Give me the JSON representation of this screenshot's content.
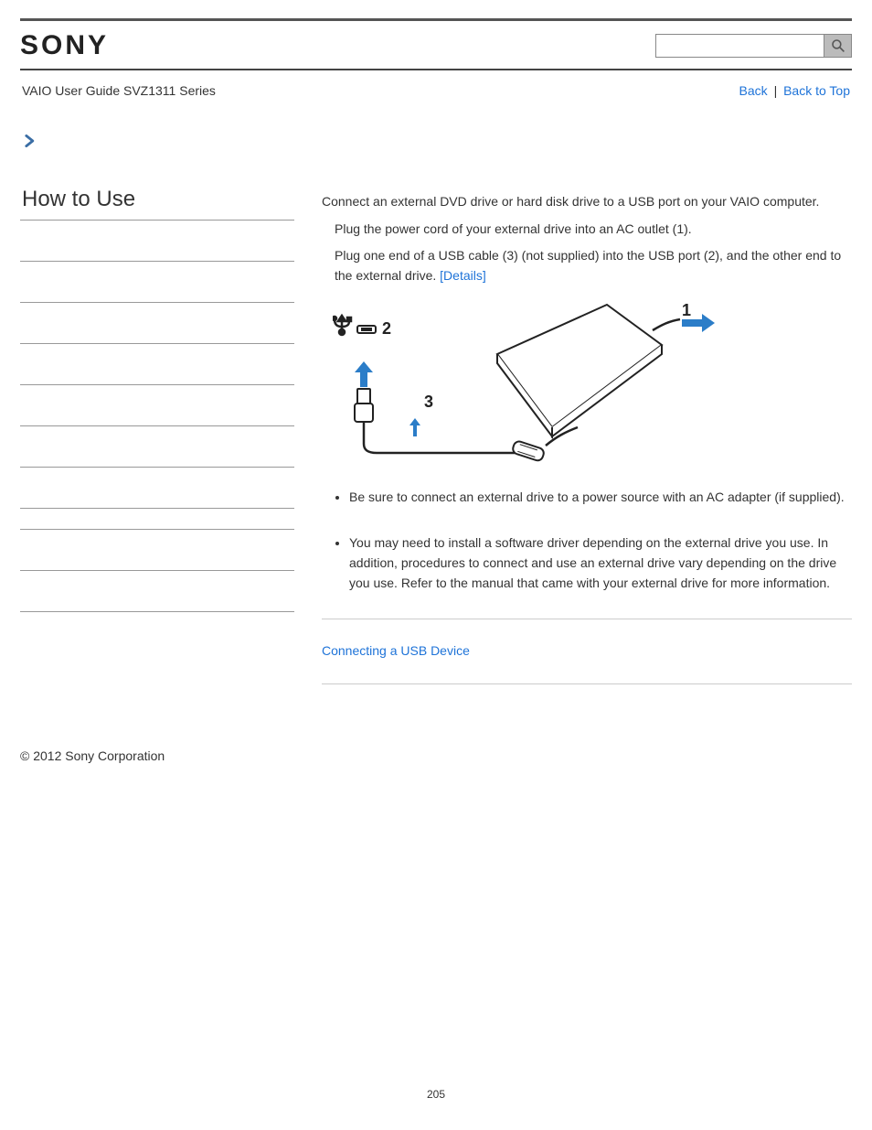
{
  "header": {
    "logo_text": "SONY",
    "search_placeholder": ""
  },
  "subheader": {
    "guide_title": "VAIO User Guide SVZ1311 Series",
    "back_label": "Back",
    "backtotop_label": "Back to Top",
    "separator": "|"
  },
  "sidebar": {
    "heading": "How to Use"
  },
  "main": {
    "intro": "Connect an external DVD drive or hard disk drive to a USB port on your VAIO computer.",
    "step1": "Plug the power cord of your external drive into an AC outlet (1).",
    "step2_part1": "Plug one end of a USB cable (3) (not supplied) into the USB port (2), and the other end to the external drive. ",
    "details_label": "[Details]",
    "bullet1": "Be sure to connect an external drive to a power source with an AC adapter (if supplied).",
    "bullet2": "You may need to install a software driver depending on the external drive you use. In addition, procedures to connect and use an external drive vary depending on the drive you use. Refer to the manual that came with your external drive for more information.",
    "related_link": "Connecting a USB Device",
    "diagram_labels": {
      "n1": "1",
      "n2": "2",
      "n3": "3"
    }
  },
  "footer": {
    "copyright": "© 2012 Sony Corporation",
    "page_number": "205"
  }
}
